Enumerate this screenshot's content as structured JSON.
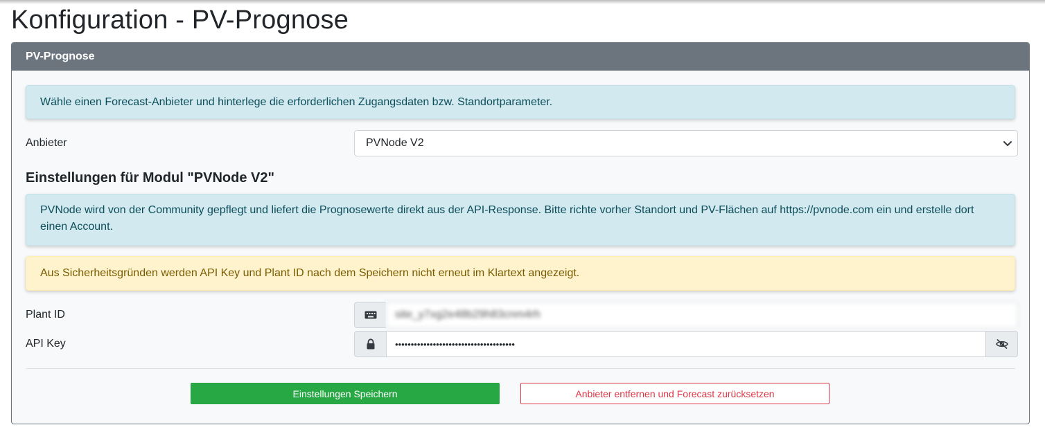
{
  "page": {
    "title": "Konfiguration - PV-Prognose"
  },
  "card": {
    "header": "PV-Prognose",
    "intro_alert": "Wähle einen Forecast-Anbieter und hinterlege die erforderlichen Zugangsdaten bzw. Standortparameter.",
    "provider": {
      "label": "Anbieter",
      "selected": "PVNode V2"
    },
    "module_heading": "Einstellungen für Modul \"PVNode V2\"",
    "module_info": "PVNode wird von der Community gepflegt und liefert die Prognosewerte direkt aus der API-Response. Bitte richte vorher Standort und PV-Flächen auf https://pvnode.com ein und erstelle dort einen Account.",
    "security_warning": "Aus Sicherheitsgründen werden API Key und Plant ID nach dem Speichern nicht erneut im Klartext angezeigt.",
    "plant_id": {
      "label": "Plant ID",
      "value": "site_y7xg2e48b29h83cnm4rh"
    },
    "api_key": {
      "label": "API Key",
      "value": "••••••••••••••••••••••••••••••••••••••"
    },
    "buttons": {
      "save": "Einstellungen Speichern",
      "remove": "Anbieter entfernen und Forecast zurücksetzen"
    }
  },
  "icons": {
    "plant_id_addon": "keyboard-icon",
    "api_key_addon": "lock-icon",
    "toggle_visibility": "eye-slash-icon",
    "select": "chevron-down-icon"
  },
  "colors": {
    "header_bg": "#6c757d",
    "info_bg": "#d1e9ef",
    "warning_bg": "#fff3cd",
    "success": "#28a745",
    "danger": "#dc3545"
  }
}
